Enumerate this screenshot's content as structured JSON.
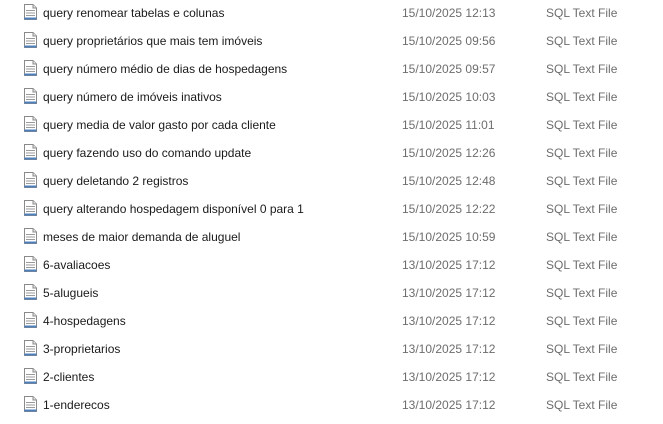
{
  "file_icon": "sql-file-icon",
  "files": [
    {
      "name": "query renomear tabelas e colunas",
      "modified": "15/10/2025 12:13",
      "type": "SQL Text File"
    },
    {
      "name": "query proprietários que mais tem imóveis",
      "modified": "15/10/2025 09:56",
      "type": "SQL Text File"
    },
    {
      "name": "query número médio de dias de hospedagens",
      "modified": "15/10/2025 09:57",
      "type": "SQL Text File"
    },
    {
      "name": "query número de imóveis inativos",
      "modified": "15/10/2025 10:03",
      "type": "SQL Text File"
    },
    {
      "name": "query media de valor gasto por cada cliente",
      "modified": "15/10/2025 11:01",
      "type": "SQL Text File"
    },
    {
      "name": "query fazendo uso do comando update",
      "modified": "15/10/2025 12:26",
      "type": "SQL Text File"
    },
    {
      "name": "query deletando 2 registros",
      "modified": "15/10/2025 12:48",
      "type": "SQL Text File"
    },
    {
      "name": "query alterando hospedagem disponível 0 para 1",
      "modified": "15/10/2025 12:22",
      "type": "SQL Text File"
    },
    {
      "name": "meses de maior demanda de aluguel",
      "modified": "15/10/2025 10:59",
      "type": "SQL Text File"
    },
    {
      "name": "6-avaliacoes",
      "modified": "13/10/2025 17:12",
      "type": "SQL Text File"
    },
    {
      "name": "5-alugueis",
      "modified": "13/10/2025 17:12",
      "type": "SQL Text File"
    },
    {
      "name": "4-hospedagens",
      "modified": "13/10/2025 17:12",
      "type": "SQL Text File"
    },
    {
      "name": "3-proprietarios",
      "modified": "13/10/2025 17:12",
      "type": "SQL Text File"
    },
    {
      "name": "2-clientes",
      "modified": "13/10/2025 17:12",
      "type": "SQL Text File"
    },
    {
      "name": "1-enderecos",
      "modified": "13/10/2025 17:12",
      "type": "SQL Text File"
    }
  ]
}
